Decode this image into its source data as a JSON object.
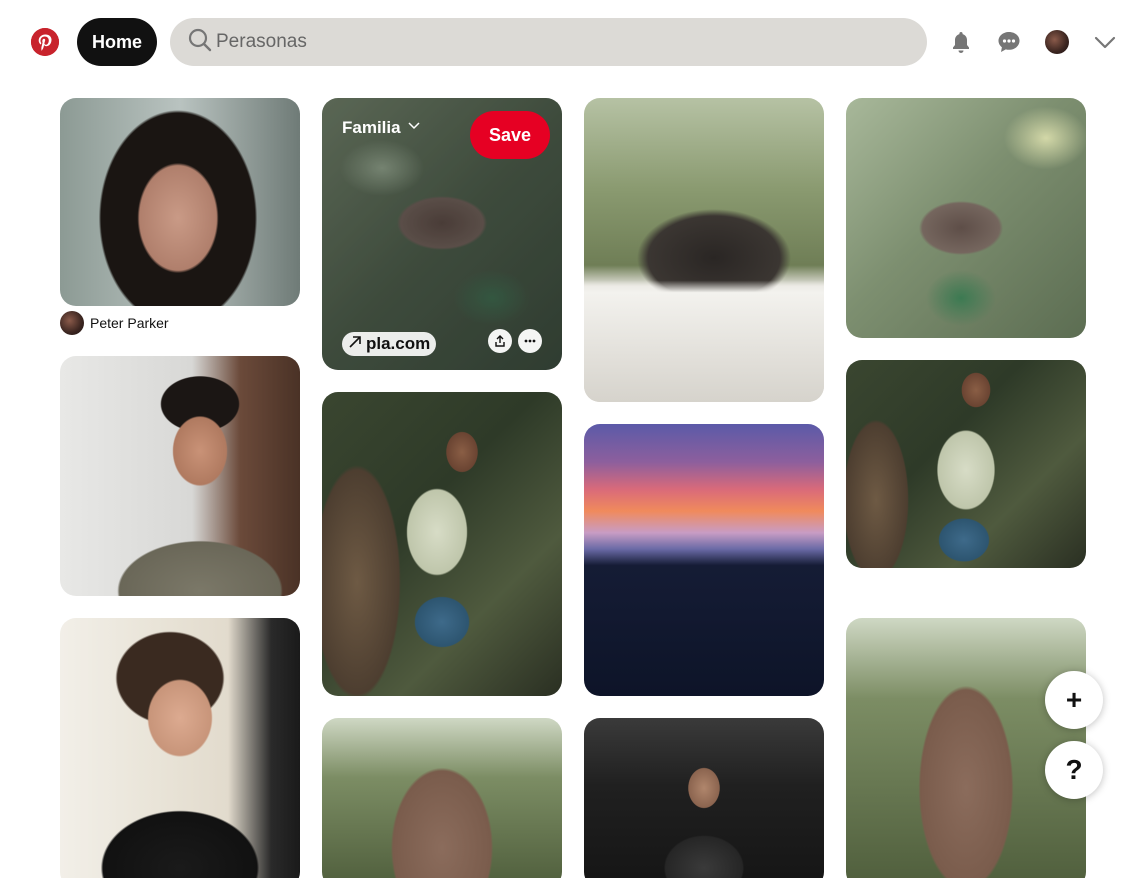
{
  "header": {
    "logo_icon": "pinterest-logo-icon",
    "home_label": "Home",
    "search_placeholder": "Perasonas",
    "notifications_icon": "bell-icon",
    "messages_icon": "chat-bubble-icon",
    "account_menu_icon": "chevron-down-icon"
  },
  "pins": [
    {
      "id": "pin-woman-portrait",
      "creator": "Peter Parker"
    },
    {
      "id": "pin-nest-hover",
      "board": "Familia",
      "save_label": "Save",
      "link_text": "pla.com"
    },
    {
      "id": "pin-group-photo"
    },
    {
      "id": "pin-nest"
    },
    {
      "id": "pin-man-glasses"
    },
    {
      "id": "pin-boy-leaves"
    },
    {
      "id": "pin-sunset"
    },
    {
      "id": "pin-boy-leaves-2"
    },
    {
      "id": "pin-woman-glasses"
    },
    {
      "id": "pin-brick-tower"
    },
    {
      "id": "pin-man-dark"
    },
    {
      "id": "pin-brick-tower-2"
    }
  ],
  "fab": {
    "create_label": "+",
    "help_label": "?"
  },
  "colors": {
    "brand": "#e60023",
    "search_bg": "#dcdad6"
  }
}
